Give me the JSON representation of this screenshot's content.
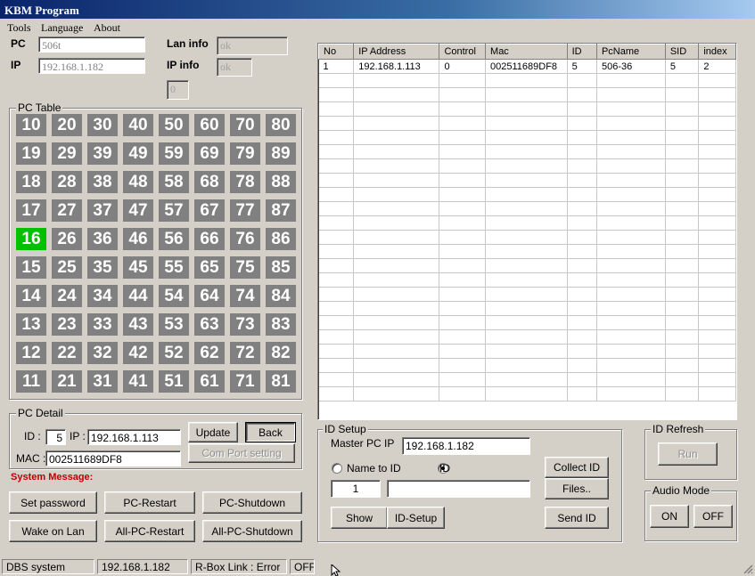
{
  "window": {
    "title": "KBM Program"
  },
  "menu": [
    "Tools",
    "Language",
    "About"
  ],
  "info": {
    "pc_label": "PC",
    "pc_value": "506t",
    "ip_label": "IP",
    "ip_value": "192.168.1.182",
    "lan_label": "Lan info",
    "lan_value": "ok",
    "ipinfo_label": "IP info",
    "ipinfo_value": "ok",
    "counter_value": "0"
  },
  "pc_table": {
    "title": "PC Table",
    "active": "16",
    "rows": [
      [
        "10",
        "20",
        "30",
        "40",
        "50",
        "60",
        "70",
        "80"
      ],
      [
        "19",
        "29",
        "39",
        "49",
        "59",
        "69",
        "79",
        "89"
      ],
      [
        "18",
        "28",
        "38",
        "48",
        "58",
        "68",
        "78",
        "88"
      ],
      [
        "17",
        "27",
        "37",
        "47",
        "57",
        "67",
        "77",
        "87"
      ],
      [
        "16",
        "26",
        "36",
        "46",
        "56",
        "66",
        "76",
        "86"
      ],
      [
        "15",
        "25",
        "35",
        "45",
        "55",
        "65",
        "75",
        "85"
      ],
      [
        "14",
        "24",
        "34",
        "44",
        "54",
        "64",
        "74",
        "84"
      ],
      [
        "13",
        "23",
        "33",
        "43",
        "53",
        "63",
        "73",
        "83"
      ],
      [
        "12",
        "22",
        "32",
        "42",
        "52",
        "62",
        "72",
        "82"
      ],
      [
        "11",
        "21",
        "31",
        "41",
        "51",
        "61",
        "71",
        "81"
      ]
    ]
  },
  "pc_detail": {
    "title": "PC Detail",
    "id_label": "ID :",
    "id_value": "5",
    "ip_label": "IP :",
    "ip_value": "192.168.1.113",
    "mac_label": "MAC :",
    "mac_value": "002511689DF8",
    "update_label": "Update",
    "back_label": "Back",
    "comport_label": "Com Port setting"
  },
  "system_message_label": "System Message:",
  "actions": {
    "set_password": "Set password",
    "pc_restart": "PC-Restart",
    "pc_shutdown": "PC-Shutdown",
    "wake_on_lan": "Wake on Lan",
    "all_pc_restart": "All-PC-Restart",
    "all_pc_shutdown": "All-PC-Shutdown"
  },
  "table": {
    "columns": [
      "No",
      "IP Address",
      "Control",
      "Mac",
      "ID",
      "PcName",
      "SID",
      "index"
    ],
    "rows": [
      [
        "1",
        "192.168.1.113",
        "0",
        "002511689DF8",
        "5",
        "506-36",
        "5",
        "2"
      ]
    ]
  },
  "id_setup": {
    "title": "ID Setup",
    "master_label": "Master PC IP",
    "master_value": "192.168.1.182",
    "radio_name": "Name to ID",
    "radio_id": "ID",
    "number_value": "1",
    "text_value": "",
    "show_label": "Show",
    "idsetup_label": "ID-Setup",
    "collect_label": "Collect ID",
    "files_label": "Files..",
    "send_label": "Send ID"
  },
  "id_refresh": {
    "title": "ID Refresh",
    "run_label": "Run"
  },
  "audio_mode": {
    "title": "Audio Mode",
    "on_label": "ON",
    "off_label": "OFF"
  },
  "status_bar": [
    "DBS system",
    "192.168.1.182",
    "R-Box Link : Error",
    "OFF"
  ],
  "colors": {
    "active_cell": "#00c000",
    "inactive_cell": "#808080",
    "system_message": "#c00000",
    "title_bar": "#0a246a"
  }
}
